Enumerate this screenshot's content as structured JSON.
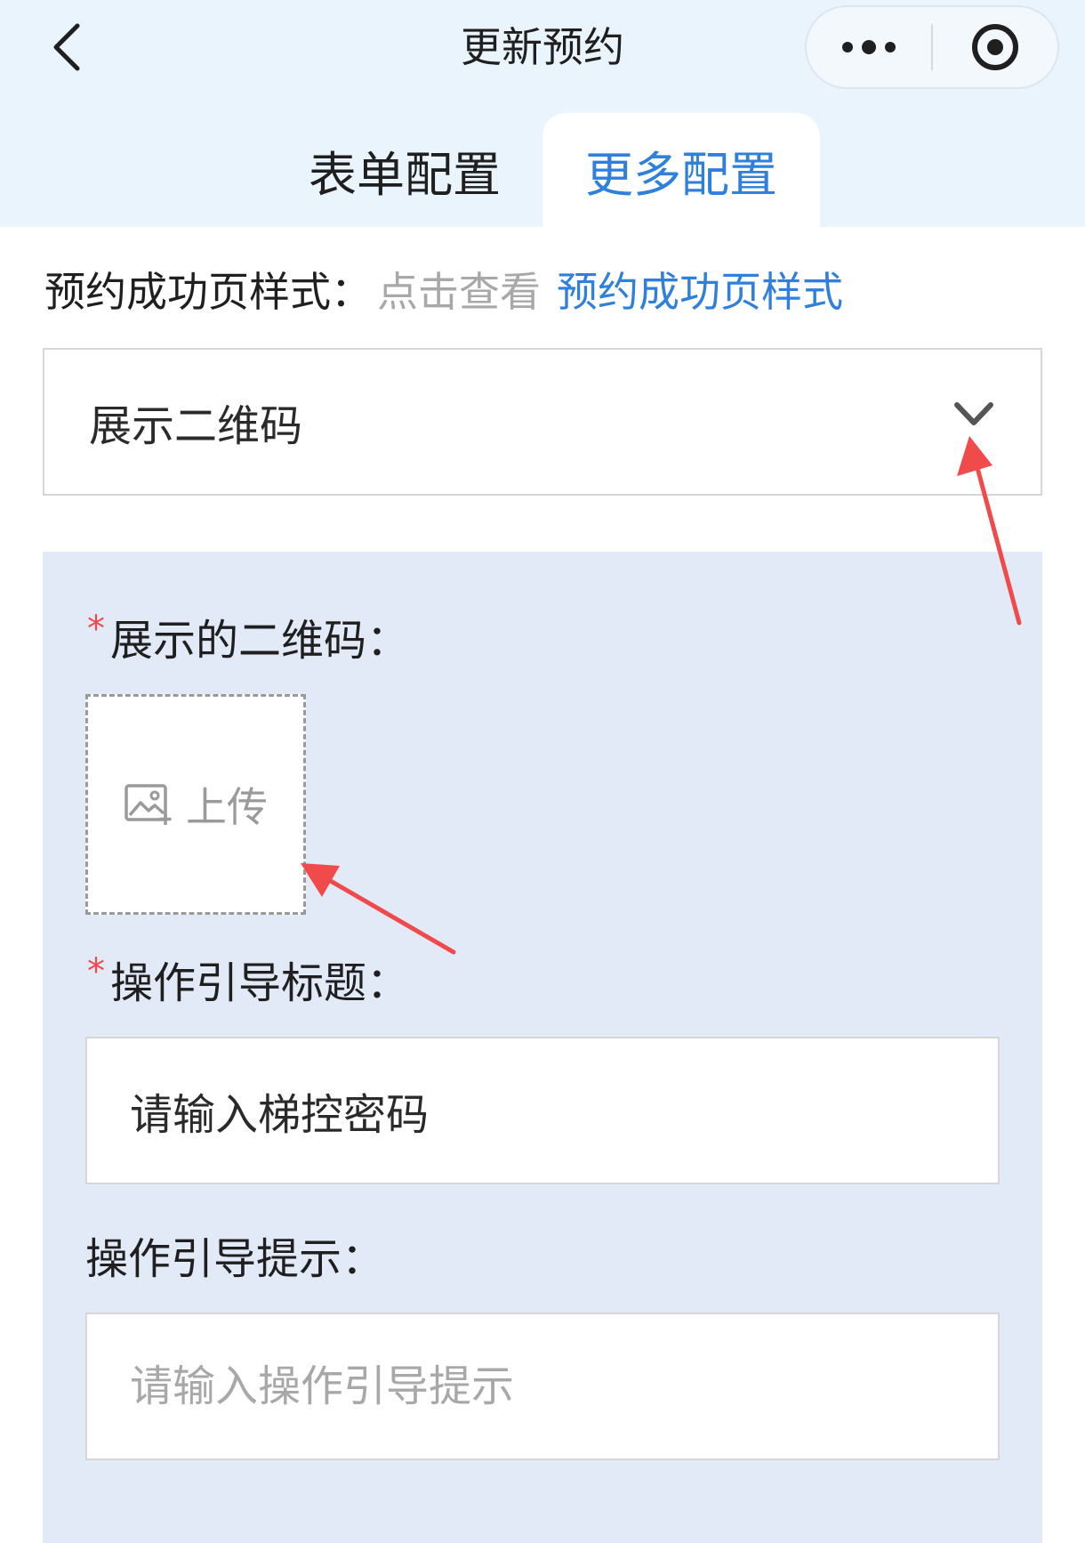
{
  "header": {
    "title": "更新预约",
    "capsule": {
      "more_icon": "more-dots-icon",
      "close_icon": "target-circle-icon"
    },
    "back_icon": "chevron-left-icon"
  },
  "tabs": [
    {
      "label": "表单配置",
      "active": false
    },
    {
      "label": "更多配置",
      "active": true
    }
  ],
  "success_style": {
    "label": "预约成功页样式：",
    "hint": "点击查看",
    "link": "预约成功页样式"
  },
  "display_select": {
    "value": "展示二维码",
    "icon": "chevron-down-icon"
  },
  "qr_field": {
    "required_mark": "*",
    "label": "展示的二维码：",
    "upload_label": "上传",
    "upload_icon": "image-add-icon"
  },
  "guide_title_field": {
    "required_mark": "*",
    "label": "操作引导标题：",
    "value": "请输入梯控密码"
  },
  "guide_hint_field": {
    "label": "操作引导提示：",
    "placeholder": "请输入操作引导提示"
  },
  "colors": {
    "accent": "#2f7fdc",
    "header_bg": "#eaf4fd",
    "panel_bg": "#e1eaf6",
    "required": "#f04a4a",
    "annotation": "#f04a4a"
  }
}
